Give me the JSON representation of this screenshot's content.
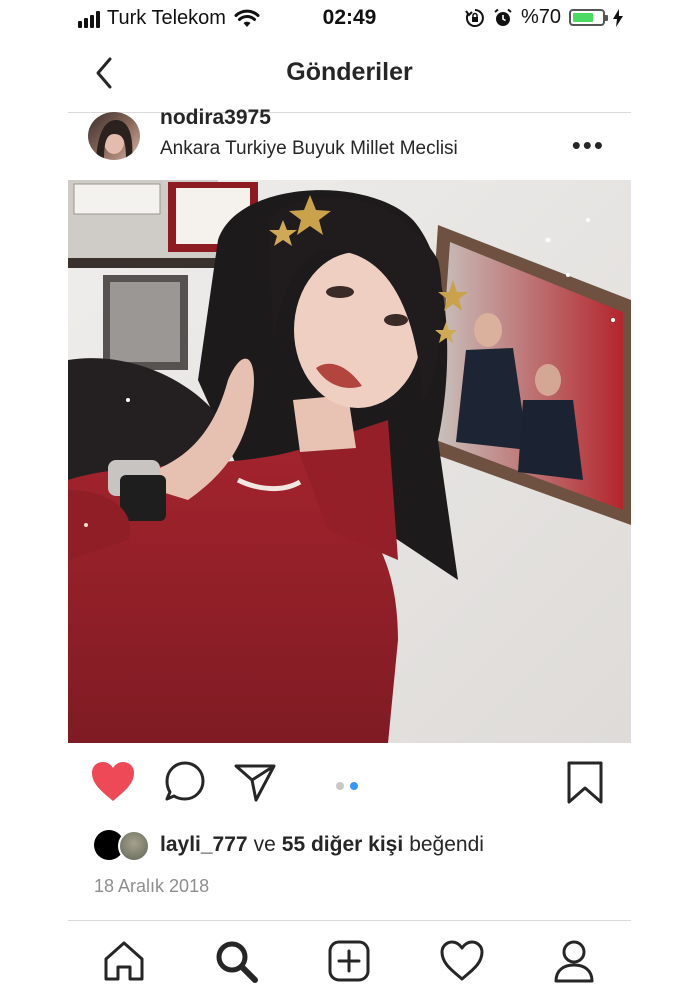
{
  "status_bar": {
    "carrier": "Turk Telekom",
    "time": "02:49",
    "battery": "%70",
    "battery_level": 0.7
  },
  "header": {
    "title": "Gönderiler"
  },
  "post": {
    "username": "nodira3975",
    "location": "Ankara Turkiye Buyuk Millet Meclisi",
    "liked": true,
    "carousel": {
      "count": 2,
      "active": 2
    },
    "likes": {
      "first_user": "layli_777",
      "joiner": "ve",
      "others": "55 diğer kişi",
      "suffix": "beğendi"
    },
    "date": "18 Aralık 2018"
  },
  "colors": {
    "like_red": "#ed4956",
    "carousel_active": "#3897f0",
    "carousel_inactive": "#c7c7c7",
    "battery_green": "#4cd964"
  },
  "icons": {
    "status": [
      "signal-icon",
      "wifi-icon",
      "orientation-lock-icon",
      "alarm-icon",
      "battery-icon",
      "charging-icon"
    ],
    "actions": [
      "heart-icon",
      "comment-icon",
      "share-icon",
      "bookmark-icon"
    ],
    "tabs": [
      "home-icon",
      "search-icon",
      "add-icon",
      "activity-heart-icon",
      "profile-icon"
    ]
  }
}
